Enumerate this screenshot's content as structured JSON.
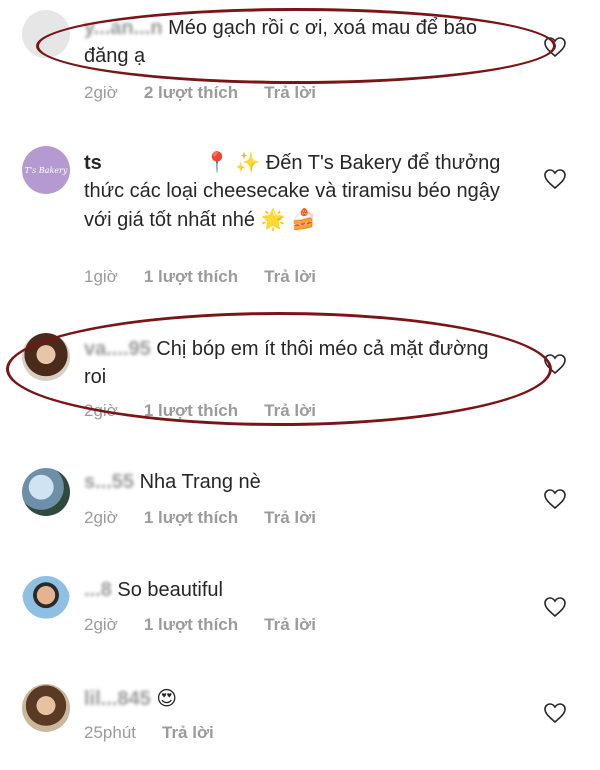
{
  "comments": [
    {
      "username": "y...an...n",
      "text": "Méo gạch rồi c ơi, xoá mau để báo đăng ạ",
      "time": "2giờ",
      "likes": "2 lượt thích",
      "reply": "Trả lời"
    },
    {
      "username": "ts",
      "avatar_text": "T's Bakery",
      "text": "Đến T's Bakery để thưởng thức các loại cheesecake và tiramisu béo ngậy với giá tốt nhất nhé",
      "emoji_pin": "📍",
      "emoji_sparkle": "✨",
      "emoji_star": "🌟",
      "emoji_cake": "🍰",
      "time": "1giờ",
      "likes": "1 lượt thích",
      "reply": "Trả lời"
    },
    {
      "username": "va....95",
      "text": "Chị bóp em ít thôi méo cả mặt đường roi",
      "time": "2giờ",
      "likes": "1 lượt thích",
      "reply": "Trả lời"
    },
    {
      "username": "s...55",
      "text": "Nha Trang nè",
      "time": "2giờ",
      "likes": "1 lượt thích",
      "reply": "Trả lời"
    },
    {
      "username": "...8",
      "text": "So beautiful",
      "time": "2giờ",
      "likes": "1 lượt thích",
      "reply": "Trả lời"
    },
    {
      "username": "lil...845",
      "emoji": "😍",
      "time": "25phút",
      "reply": "Trả lời"
    }
  ],
  "colors": {
    "annotation_oval": "#7a1416",
    "meta_text": "#9b9b9b",
    "body_text": "#262626"
  }
}
